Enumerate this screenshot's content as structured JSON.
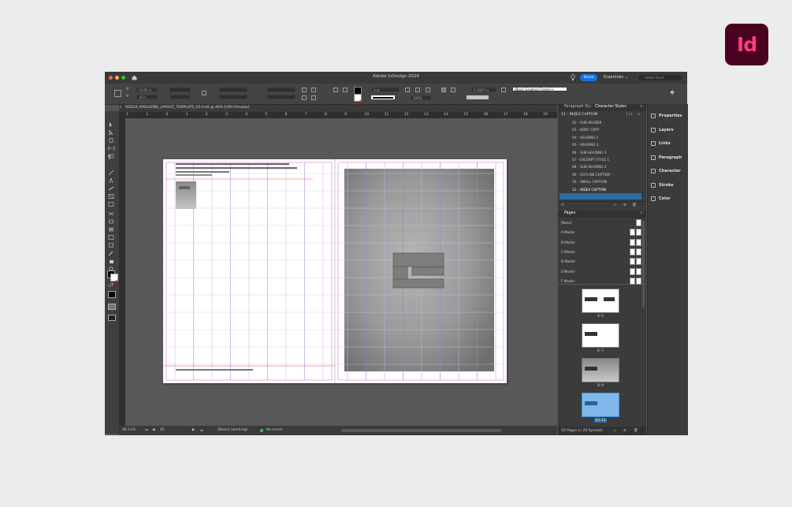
{
  "app": {
    "title": "Adobe InDesign 2024",
    "logo_text": "Id",
    "share_label": "Share",
    "workspace": "Essentials",
    "search_placeholder": "Adobe Stock"
  },
  "controlbar": {
    "x_label": "X:",
    "y_label": "Y:",
    "x_value": "13.05 in",
    "y_value": "-9 in",
    "stroke_weight": "0 pt",
    "scale": "100%",
    "frame_style": "[Basic Graphics Frame]+",
    "gutter": "0.1667 in"
  },
  "document": {
    "tab_title": "REDUX_MAGAZINE_LAYOUT_TEMPLATE_V3.indd @ 46% [GPU Preview]"
  },
  "ruler": {
    "ticks": [
      "2",
      "1",
      "0",
      "1",
      "2",
      "3",
      "4",
      "5",
      "6",
      "7",
      "8",
      "9",
      "10",
      "11",
      "12",
      "13",
      "14",
      "15",
      "16",
      "17",
      "18",
      "19"
    ]
  },
  "status": {
    "zoom": "46.11%",
    "page": "45",
    "preflight_profile": "[Basic] (working)",
    "errors": "No errors"
  },
  "panels": {
    "tabs": [
      "Paragraph Sty",
      "Character Styles"
    ],
    "current_style": "11 – INDEX CAPTION",
    "character_styles": [
      "02 – SUB HEADER",
      "03 – BODY COPY",
      "04 – HEADING 2",
      "05 – HEADING 3",
      "06 – SUB HEADING 3",
      "07 – EXCERPT STYLE 1",
      "08 – SUB HEADING 4",
      "09 – OUTLINE CAPTION",
      "10 – SMALL CAPTION",
      "11 – INDEX CAPTION"
    ],
    "pages_title": "Pages",
    "masters": [
      "[None]",
      "A-Master",
      "B-Master",
      "C-Master",
      "D-Master",
      "E-Master",
      "F-Master"
    ],
    "spreads": [
      "4–5",
      "6–7",
      "8–9",
      "10–11"
    ],
    "footer": "50 Pages in 26 Spreads"
  },
  "dock": [
    "Properties",
    "Layers",
    "Links",
    "Paragraph",
    "Character",
    "Stroke",
    "Color"
  ],
  "colors": {
    "accent": "#1473e6",
    "selection": "#2d6ca2",
    "logo_bg": "#49021f",
    "logo_fg": "#ff3c84"
  }
}
